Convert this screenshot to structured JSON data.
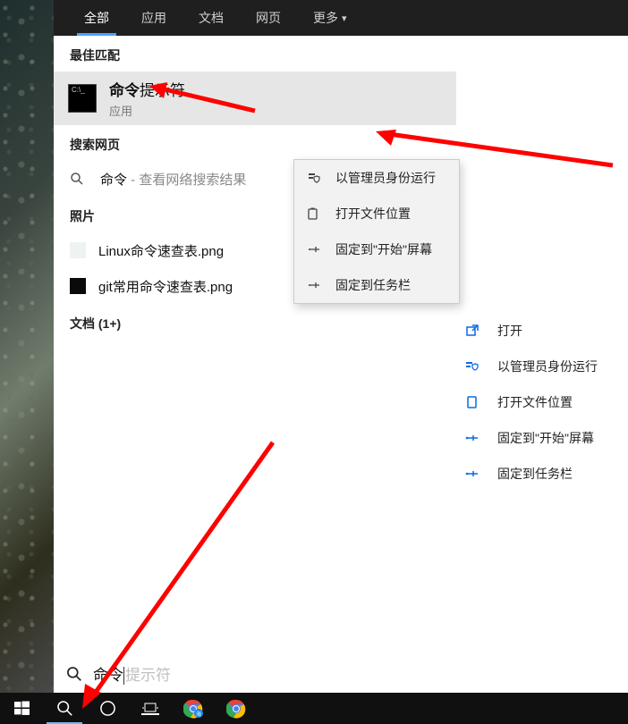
{
  "tabs": {
    "all": "全部",
    "apps": "应用",
    "docs": "文档",
    "web": "网页",
    "more": "更多"
  },
  "sections": {
    "best_match": "最佳匹配",
    "search_web": "搜索网页",
    "photos": "照片",
    "documents": "文档 (1+)"
  },
  "best": {
    "title_hl": "命令",
    "title_rest": "提示符",
    "subtitle": "应用"
  },
  "web_search": {
    "query": "命令",
    "suffix": " - 查看网络搜索结果"
  },
  "photos_list": [
    "Linux命令速查表.png",
    "git常用命令速查表.png"
  ],
  "context_menu": {
    "run_admin": "以管理员身份运行",
    "open_location": "打开文件位置",
    "pin_start": "固定到\"开始\"屏幕",
    "pin_taskbar": "固定到任务栏"
  },
  "right_panel": {
    "open": "打开",
    "run_admin": "以管理员身份运行",
    "open_location": "打开文件位置",
    "pin_start": "固定到\"开始\"屏幕",
    "pin_taskbar": "固定到任务栏"
  },
  "search_box": {
    "typed": "命令",
    "ghost": "提示符"
  }
}
